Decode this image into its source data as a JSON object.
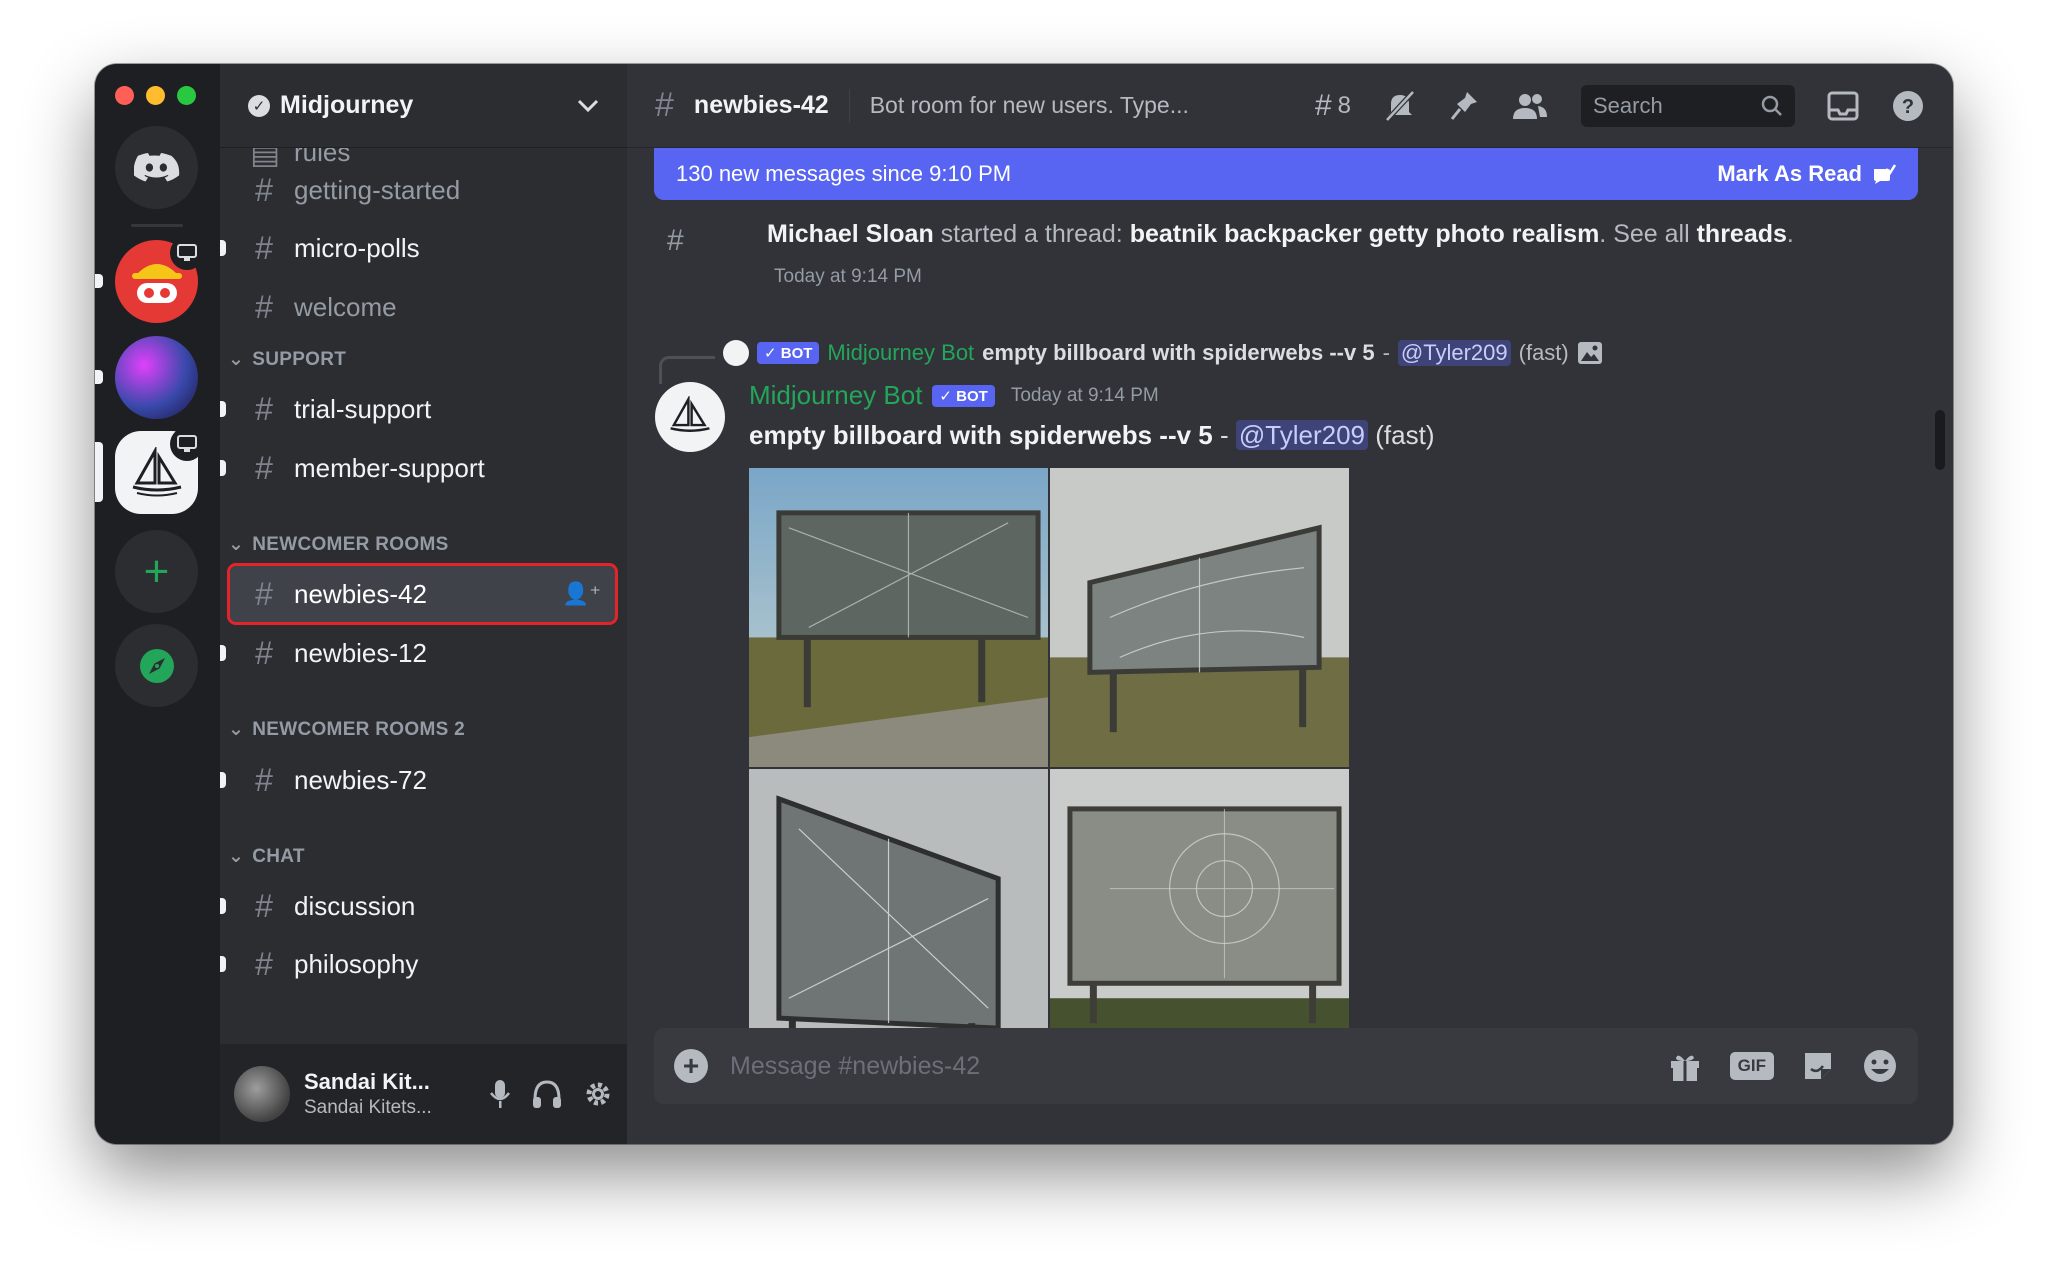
{
  "sidebar": {
    "guild_name": "Midjourney",
    "partial_top": "rules",
    "channels_top": [
      {
        "label": "getting-started",
        "unread": false
      },
      {
        "label": "micro-polls",
        "unread": true
      },
      {
        "label": "welcome",
        "unread": false
      }
    ],
    "support": {
      "label": "SUPPORT",
      "channels": [
        {
          "label": "trial-support"
        },
        {
          "label": "member-support"
        }
      ]
    },
    "newcomer": {
      "label": "NEWCOMER ROOMS",
      "channels": [
        {
          "label": "newbies-42"
        },
        {
          "label": "newbies-12"
        }
      ]
    },
    "newcomer2": {
      "label": "NEWCOMER ROOMS 2",
      "channels": [
        {
          "label": "newbies-72"
        }
      ]
    },
    "chat": {
      "label": "CHAT",
      "channels": [
        {
          "label": "discussion"
        },
        {
          "label": "philosophy"
        }
      ]
    }
  },
  "user": {
    "display_name": "Sandai Kit...",
    "status": "Sandai Kitets..."
  },
  "header": {
    "channel": "newbies-42",
    "topic": "Bot room for new users. Type...",
    "threads_count": "8",
    "search_placeholder": "Search"
  },
  "banner": {
    "text": "130 new messages since 9:10 PM",
    "action": "Mark As Read"
  },
  "system_message": {
    "author": "Michael Sloan",
    "verb": "started a thread:",
    "thread": "beatnik backpacker getty photo realism",
    "see_all": "See all",
    "threads_link": "threads",
    "timestamp": "Today at 9:14 PM"
  },
  "reply": {
    "badge": "BOT",
    "author": "Midjourney Bot",
    "prompt": "empty billboard with spiderwebs --v 5",
    "dash": "-",
    "mention": "@Tyler209",
    "mode": "(fast)"
  },
  "message": {
    "author": "Midjourney Bot",
    "badge": "BOT",
    "timestamp": "Today at 9:14 PM",
    "prompt": "empty billboard with spiderwebs --v 5",
    "dash": "-",
    "mention": "@Tyler209",
    "mode": "(fast)"
  },
  "composer": {
    "placeholder": "Message #newbies-42",
    "gif_label": "GIF"
  },
  "colors": {
    "accent": "#5865f2",
    "bot_green": "#23a55a",
    "selected_outline": "#e3242b"
  }
}
